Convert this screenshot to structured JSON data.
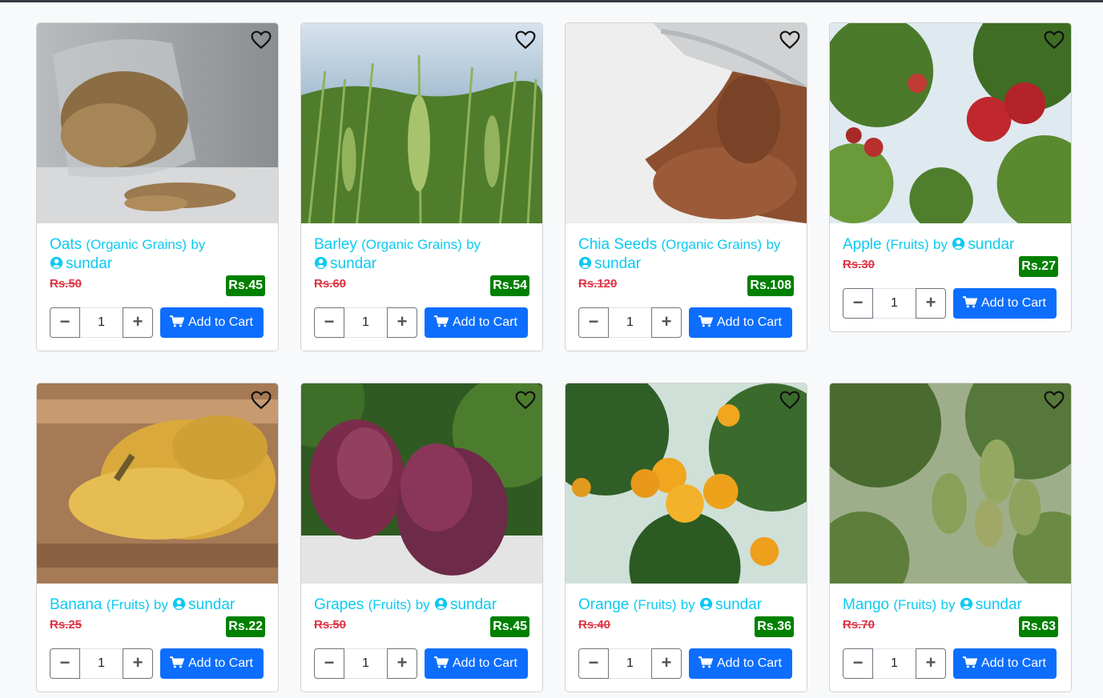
{
  "products": [
    {
      "name": "Oats",
      "category": "(Organic Grains)",
      "by": "by",
      "seller": "sundar",
      "old_price": "Rs.50",
      "price": "Rs.45",
      "qty": "1",
      "cart_label": "Add to Cart"
    },
    {
      "name": "Barley",
      "category": "(Organic Grains)",
      "by": "by",
      "seller": "sundar",
      "old_price": "Rs.60",
      "price": "Rs.54",
      "qty": "1",
      "cart_label": "Add to Cart"
    },
    {
      "name": "Chia Seeds",
      "category": "(Organic Grains)",
      "by": "by",
      "seller": "sundar",
      "old_price": "Rs.120",
      "price": "Rs.108",
      "qty": "1",
      "cart_label": "Add to Cart"
    },
    {
      "name": "Apple",
      "category": "(Fruits)",
      "by": "by",
      "seller": "sundar",
      "old_price": "Rs.30",
      "price": "Rs.27",
      "qty": "1",
      "cart_label": "Add to Cart"
    },
    {
      "name": "Banana",
      "category": "(Fruits)",
      "by": "by",
      "seller": "sundar",
      "old_price": "Rs.25",
      "price": "Rs.22",
      "qty": "1",
      "cart_label": "Add to Cart"
    },
    {
      "name": "Grapes",
      "category": "(Fruits)",
      "by": "by",
      "seller": "sundar",
      "old_price": "Rs.50",
      "price": "Rs.45",
      "qty": "1",
      "cart_label": "Add to Cart"
    },
    {
      "name": "Orange",
      "category": "(Fruits)",
      "by": "by",
      "seller": "sundar",
      "old_price": "Rs.40",
      "price": "Rs.36",
      "qty": "1",
      "cart_label": "Add to Cart"
    },
    {
      "name": "Mango",
      "category": "(Fruits)",
      "by": "by",
      "seller": "sundar",
      "old_price": "Rs.70",
      "price": "Rs.63",
      "qty": "1",
      "cart_label": "Add to Cart"
    }
  ],
  "icons": {
    "wishlist": "heart-outline-icon",
    "seller": "user-circle-icon",
    "cart": "shopping-cart-icon",
    "decrease": "minus-icon",
    "increase": "plus-icon"
  },
  "colors": {
    "title": "#0dcaf0",
    "old_price": "#dc3545",
    "price_badge": "#008000",
    "cart_button": "#0d6efd"
  }
}
